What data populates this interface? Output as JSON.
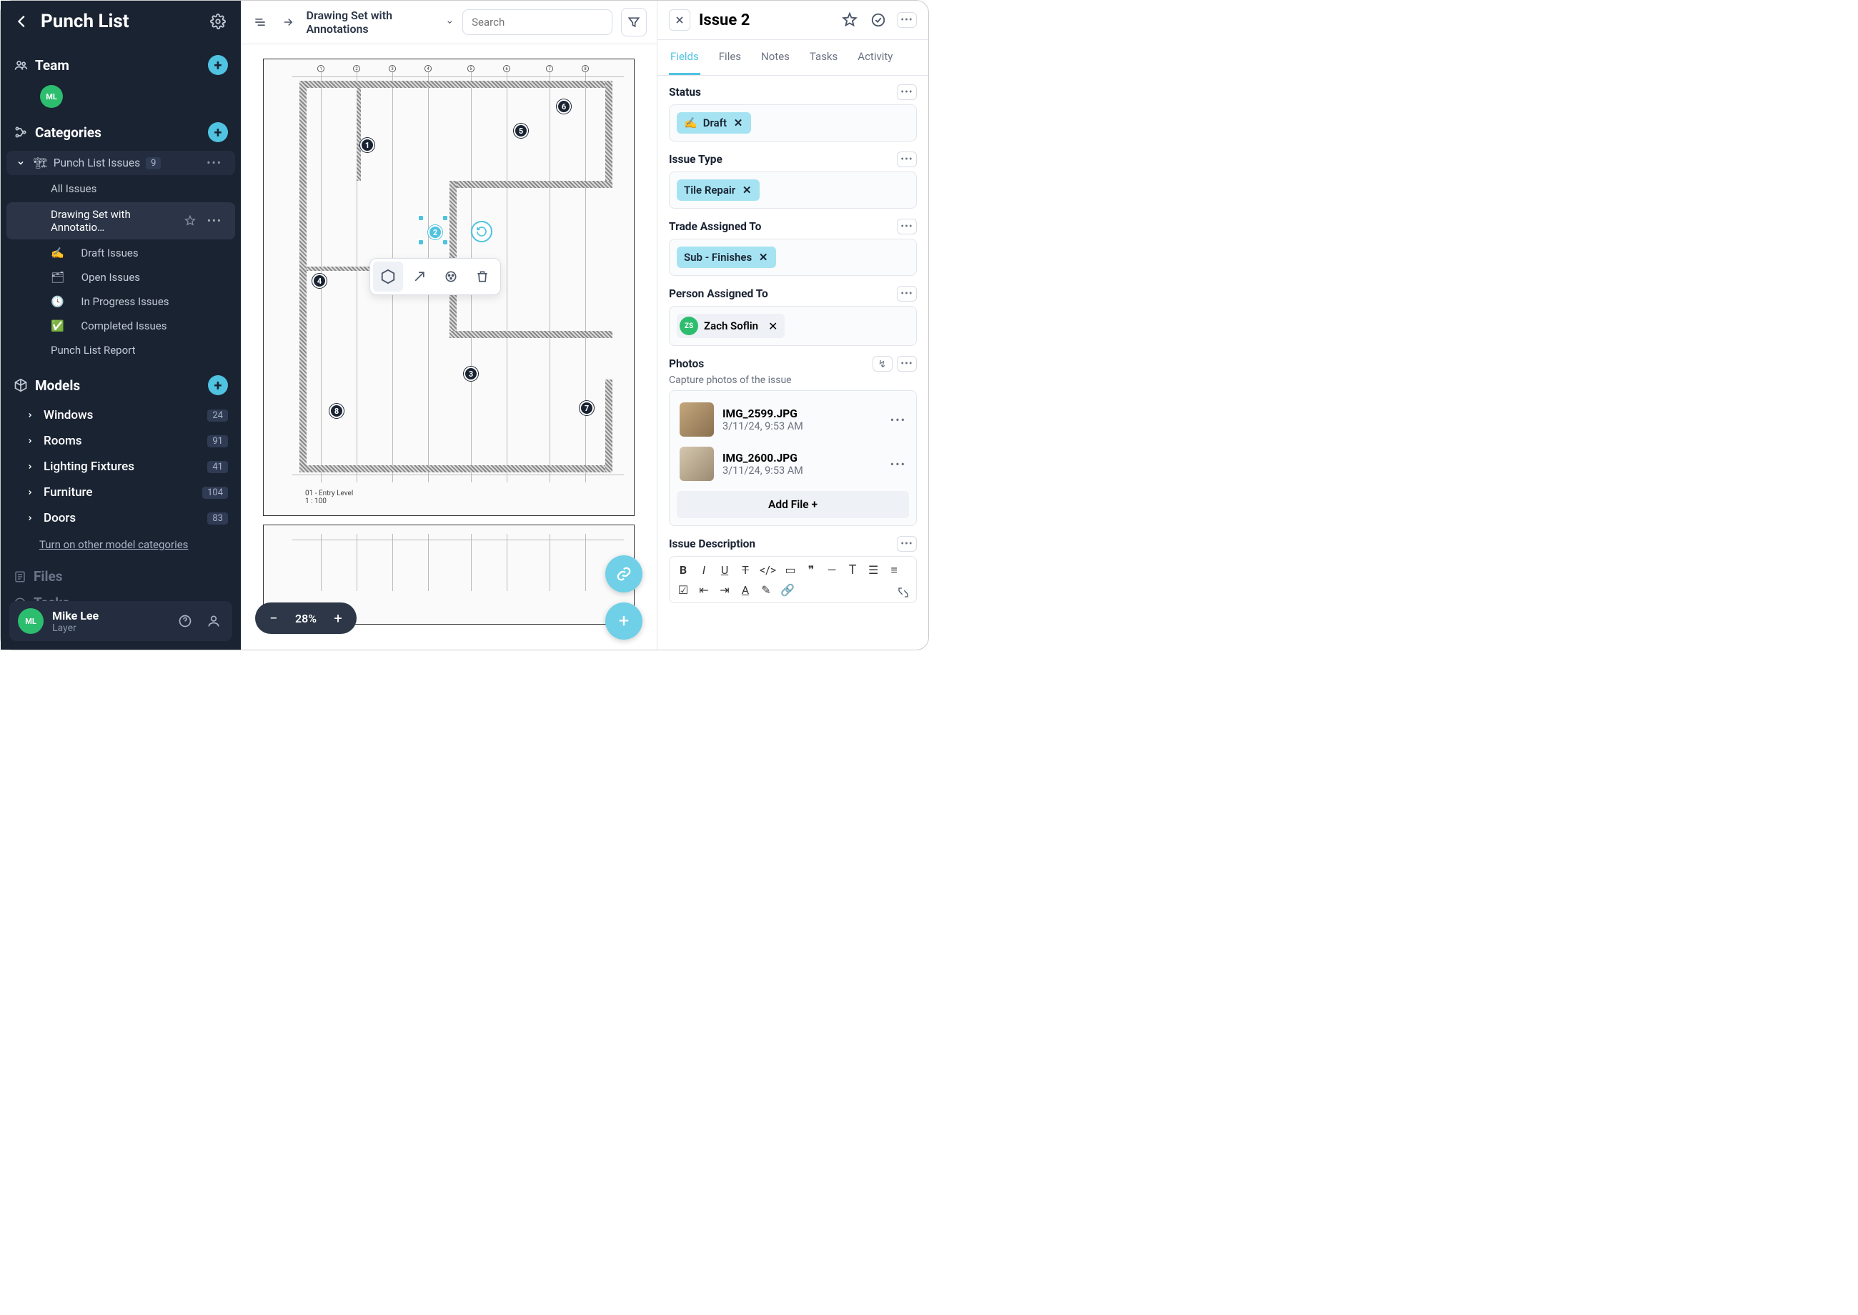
{
  "sidebar": {
    "title": "Punch List",
    "team_label": "Team",
    "team_avatar": "ML",
    "categories_label": "Categories",
    "categories": [
      {
        "name": "Punch List Issues",
        "count": "9",
        "icon": "🏗",
        "items": [
          {
            "label": "All Issues"
          },
          {
            "label": "Drawing Set with Annotatio…",
            "active": true,
            "starred": true
          },
          {
            "label": "Draft Issues",
            "icon": "✍️"
          },
          {
            "label": "Open Issues",
            "icon": "🗂"
          },
          {
            "label": "In Progress Issues",
            "icon": "🕓"
          },
          {
            "label": "Completed Issues",
            "icon": "✅"
          },
          {
            "label": "Punch List Report"
          }
        ]
      }
    ],
    "models_label": "Models",
    "models": [
      {
        "name": "Windows",
        "count": "24"
      },
      {
        "name": "Rooms",
        "count": "91"
      },
      {
        "name": "Lighting Fixtures",
        "count": "41"
      },
      {
        "name": "Furniture",
        "count": "104"
      },
      {
        "name": "Doors",
        "count": "83"
      }
    ],
    "turn_on": "Turn on other model categories",
    "files_label": "Files",
    "tasks_label": "Tasks",
    "user": {
      "initials": "ML",
      "name": "Mike Lee",
      "org": "Layer"
    }
  },
  "main": {
    "crumb": "Drawing Set with Annotations",
    "search_placeholder": "Search",
    "zoom": "28%",
    "drawing_label": "01 - Entry Level",
    "drawing_scale": "1 : 100",
    "pins": [
      "1",
      "2",
      "3",
      "4",
      "5",
      "6",
      "7",
      "8"
    ]
  },
  "details": {
    "title": "Issue 2",
    "tabs": [
      "Fields",
      "Files",
      "Notes",
      "Tasks",
      "Activity"
    ],
    "active_tab": "Fields",
    "fields": {
      "status": {
        "label": "Status",
        "chip": "Draft",
        "icon": "✍️"
      },
      "issue_type": {
        "label": "Issue Type",
        "chip": "Tile Repair"
      },
      "trade": {
        "label": "Trade Assigned To",
        "chip": "Sub - Finishes"
      },
      "person": {
        "label": "Person Assigned To",
        "name": "Zach Soflin",
        "initials": "ZS"
      },
      "photos": {
        "label": "Photos",
        "sub": "Capture photos of the issue",
        "items": [
          {
            "name": "IMG_2599.JPG",
            "date": "3/11/24, 9:53 AM"
          },
          {
            "name": "IMG_2600.JPG",
            "date": "3/11/24, 9:53 AM"
          }
        ],
        "add_label": "Add File"
      },
      "description": {
        "label": "Issue Description"
      }
    }
  }
}
